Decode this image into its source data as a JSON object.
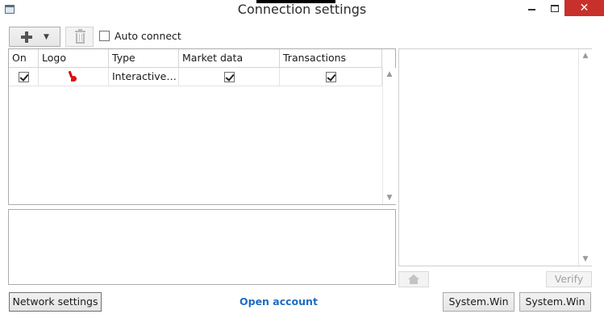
{
  "window": {
    "title": "Connection settings",
    "controls": {
      "minimize": "minimize",
      "maximize": "maximize",
      "close": "✕"
    }
  },
  "toolbar": {
    "add_icon": "plus-icon",
    "dropdown_icon": "⌄",
    "delete_icon": "trash-icon",
    "auto_connect": {
      "label": "Auto connect",
      "checked": false
    }
  },
  "grid": {
    "columns": [
      "On",
      "Logo",
      "Type",
      "Market data",
      "Transactions"
    ],
    "rows": [
      {
        "on": true,
        "logo": "red-logo",
        "type": "Interactive…",
        "market_data": true,
        "transactions": true
      }
    ]
  },
  "right_panel": {
    "home_icon": "home-icon",
    "verify_label": "Verify"
  },
  "footer": {
    "network_settings": "Network settings",
    "open_account": "Open account",
    "system_win_1": "System.Win",
    "system_win_2": "System.Win"
  },
  "colors": {
    "close_button": "#c7302b",
    "link": "#1f6cc1",
    "logo_red": "#e01010"
  }
}
